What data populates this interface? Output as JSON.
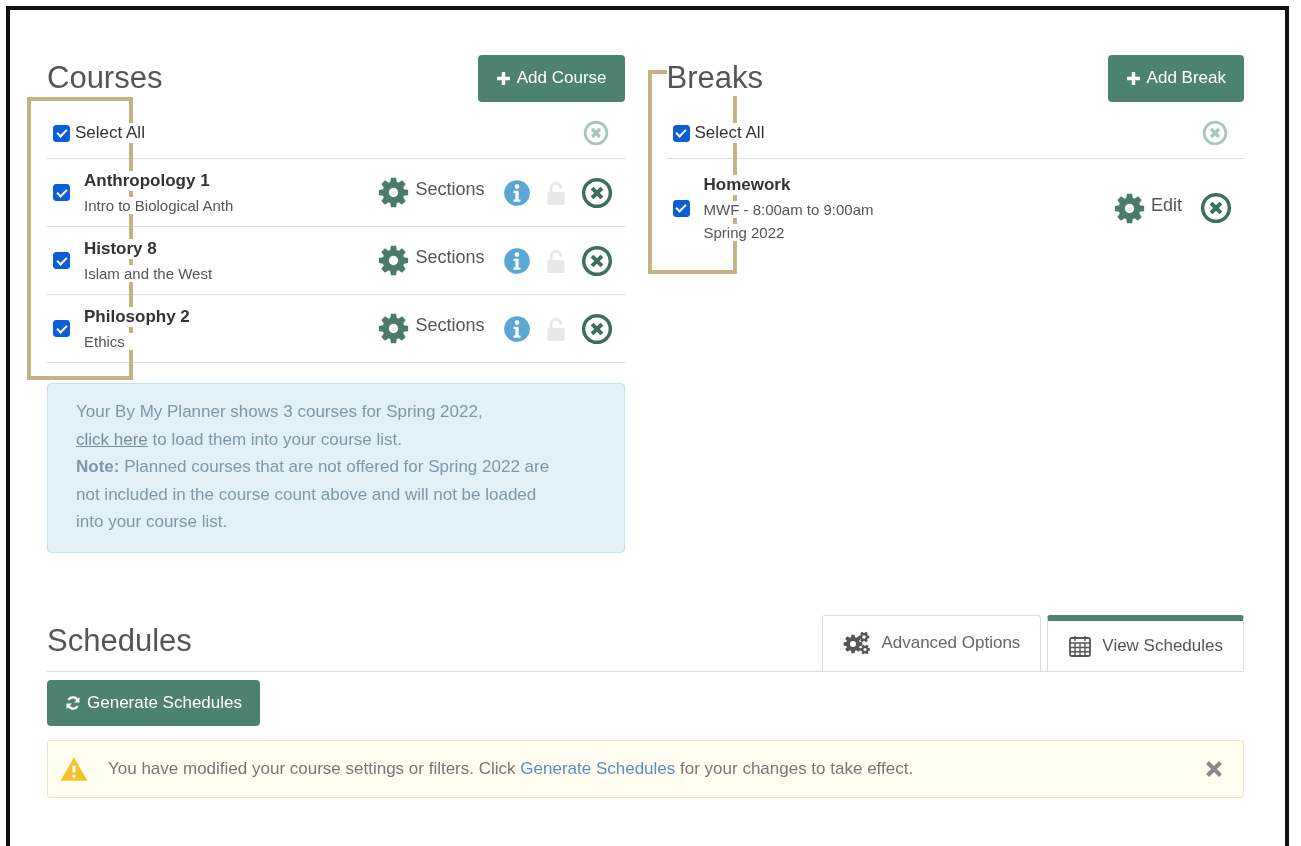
{
  "courses": {
    "title": "Courses",
    "add_button": "Add Course",
    "select_all": {
      "label": "Select All",
      "checked": true
    },
    "items": [
      {
        "name": "Anthropology 1",
        "subtitle": "Intro to Biological Anth",
        "checked": true,
        "sections_label": "Sections",
        "locked": false
      },
      {
        "name": "History 8",
        "subtitle": "Islam and the West",
        "checked": true,
        "sections_label": "Sections",
        "locked": false
      },
      {
        "name": "Philosophy 2",
        "subtitle": "Ethics",
        "checked": true,
        "sections_label": "Sections",
        "locked": false
      }
    ],
    "notice": {
      "text_before": "Your By My Planner shows 3 courses for Spring 2022,",
      "link": "click here",
      "text_after": "to load them into your course list.",
      "note": "**Note:** Planned courses that are not offered for Spring 2022 are not included in the course count above and will not be loaded into your course list."
    }
  },
  "breaks": {
    "title": "Breaks",
    "add_button": "Add Break",
    "select_all": {
      "label": "Select All",
      "checked": true
    },
    "items": [
      {
        "name": "Homework",
        "days_time": "MWF - 8:00am to 9:00am",
        "term": "Spring 2022",
        "checked": true,
        "edit_label": "Edit"
      }
    ]
  },
  "schedules": {
    "title": "Schedules",
    "tabs": [
      {
        "label": "Advanced Options",
        "kind": "options",
        "selected": false
      },
      {
        "label": "View Schedules",
        "kind": "calendar",
        "selected": true
      }
    ],
    "generate_button": "Generate Schedules",
    "alert": {
      "text_before": "You have modified your course settings or filters. Click",
      "link": "Generate Schedules",
      "text_after": "for your changes to take effect."
    }
  }
}
